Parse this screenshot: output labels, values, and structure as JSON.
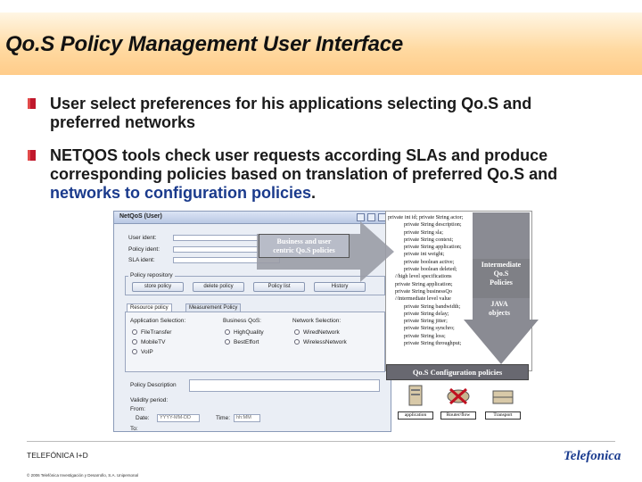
{
  "slide": {
    "title": "Qo.S Policy Management User Interface",
    "bullets": [
      {
        "text_1": "User select preferences for his applications selecting Qo.S and",
        "text_2": "preferred networks"
      },
      {
        "text_1": "NETQOS  tools check user requests according SLAs and produce",
        "text_2": "corresponding policies based on translation of preferred Qo.S and",
        "text_3a": "networks to configuration policies",
        "text_3b": "."
      }
    ]
  },
  "window": {
    "title": "NetQoS (User)",
    "labels": {
      "user_ident": "User ident:",
      "policy_ident": "Policy ident:",
      "sla_ident": "SLA ident:",
      "policy_repository": "Policy repository",
      "policy_description": "Policy Description",
      "validity_period": "Validity period:",
      "from": "From:",
      "date": "Date:",
      "time": "Time:",
      "to": "To:"
    },
    "buttons": {
      "store": "store policy",
      "delete": "delete policy",
      "list": "Policy list",
      "history": "History"
    },
    "tabs": {
      "resource": "Resource policy",
      "measurement": "Measurement Policy"
    },
    "columns": {
      "application": "Application Selection:",
      "business": "Business QoS:",
      "network": "Network Selection:"
    },
    "applications": [
      "FileTransfer",
      "MobileTV",
      "VoIP"
    ],
    "business": [
      "HighQuality",
      "BestEffort"
    ],
    "networks": [
      "WiredNetwork",
      "WirelessNetwork"
    ],
    "date_placeholder": "YYYY-MM-DD",
    "time_placeholder": "hh:MM"
  },
  "code": [
    "private int id; private String actor;",
    "private String description;",
    "private String sla;",
    "private String context;",
    "private String application;",
    "private int weight;",
    "private boolean active;",
    "private boolean deleted;",
    "//high level specifications",
    "private String application;",
    "private String businessQo",
    "//intermediate level value",
    "private String bandwidth;",
    "private String delay;",
    "private String jitter;",
    "private String synchro;",
    "private String loss;",
    "private String throughput;"
  ],
  "diagram": {
    "business_box": {
      "l1": "Business and user",
      "l2": "centric Qo.S policies"
    },
    "intermediate": {
      "l1": "Intermediate",
      "l2": "Qo.S",
      "l3": "Policies"
    },
    "java": {
      "l1": "JAVA",
      "l2": "objects"
    },
    "config": "Qo.S Configuration policies",
    "devices": [
      "application",
      "Router/flow",
      "Transport"
    ]
  },
  "footer": {
    "org": "TELEFÓNICA I+D",
    "copyright": "© 2006 Telefónica Investigación y Desarrollo, S.A. Unipersonal",
    "logo": "Telefonica"
  },
  "colors": {
    "bullet": "#c0182c",
    "title_bg": "#ffd9a0",
    "link_blue": "#1a3a8c"
  }
}
